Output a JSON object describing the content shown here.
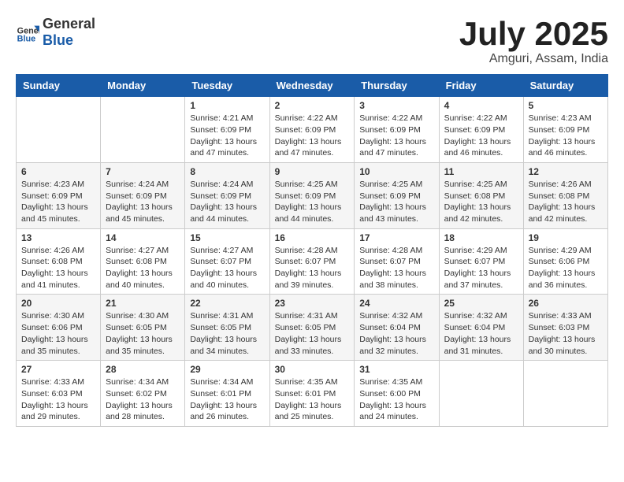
{
  "header": {
    "logo_general": "General",
    "logo_blue": "Blue",
    "month_title": "July 2025",
    "location": "Amguri, Assam, India"
  },
  "days_of_week": [
    "Sunday",
    "Monday",
    "Tuesday",
    "Wednesday",
    "Thursday",
    "Friday",
    "Saturday"
  ],
  "weeks": [
    [
      {
        "day": "",
        "info": ""
      },
      {
        "day": "",
        "info": ""
      },
      {
        "day": "1",
        "info": "Sunrise: 4:21 AM\nSunset: 6:09 PM\nDaylight: 13 hours and 47 minutes."
      },
      {
        "day": "2",
        "info": "Sunrise: 4:22 AM\nSunset: 6:09 PM\nDaylight: 13 hours and 47 minutes."
      },
      {
        "day": "3",
        "info": "Sunrise: 4:22 AM\nSunset: 6:09 PM\nDaylight: 13 hours and 47 minutes."
      },
      {
        "day": "4",
        "info": "Sunrise: 4:22 AM\nSunset: 6:09 PM\nDaylight: 13 hours and 46 minutes."
      },
      {
        "day": "5",
        "info": "Sunrise: 4:23 AM\nSunset: 6:09 PM\nDaylight: 13 hours and 46 minutes."
      }
    ],
    [
      {
        "day": "6",
        "info": "Sunrise: 4:23 AM\nSunset: 6:09 PM\nDaylight: 13 hours and 45 minutes."
      },
      {
        "day": "7",
        "info": "Sunrise: 4:24 AM\nSunset: 6:09 PM\nDaylight: 13 hours and 45 minutes."
      },
      {
        "day": "8",
        "info": "Sunrise: 4:24 AM\nSunset: 6:09 PM\nDaylight: 13 hours and 44 minutes."
      },
      {
        "day": "9",
        "info": "Sunrise: 4:25 AM\nSunset: 6:09 PM\nDaylight: 13 hours and 44 minutes."
      },
      {
        "day": "10",
        "info": "Sunrise: 4:25 AM\nSunset: 6:09 PM\nDaylight: 13 hours and 43 minutes."
      },
      {
        "day": "11",
        "info": "Sunrise: 4:25 AM\nSunset: 6:08 PM\nDaylight: 13 hours and 42 minutes."
      },
      {
        "day": "12",
        "info": "Sunrise: 4:26 AM\nSunset: 6:08 PM\nDaylight: 13 hours and 42 minutes."
      }
    ],
    [
      {
        "day": "13",
        "info": "Sunrise: 4:26 AM\nSunset: 6:08 PM\nDaylight: 13 hours and 41 minutes."
      },
      {
        "day": "14",
        "info": "Sunrise: 4:27 AM\nSunset: 6:08 PM\nDaylight: 13 hours and 40 minutes."
      },
      {
        "day": "15",
        "info": "Sunrise: 4:27 AM\nSunset: 6:07 PM\nDaylight: 13 hours and 40 minutes."
      },
      {
        "day": "16",
        "info": "Sunrise: 4:28 AM\nSunset: 6:07 PM\nDaylight: 13 hours and 39 minutes."
      },
      {
        "day": "17",
        "info": "Sunrise: 4:28 AM\nSunset: 6:07 PM\nDaylight: 13 hours and 38 minutes."
      },
      {
        "day": "18",
        "info": "Sunrise: 4:29 AM\nSunset: 6:07 PM\nDaylight: 13 hours and 37 minutes."
      },
      {
        "day": "19",
        "info": "Sunrise: 4:29 AM\nSunset: 6:06 PM\nDaylight: 13 hours and 36 minutes."
      }
    ],
    [
      {
        "day": "20",
        "info": "Sunrise: 4:30 AM\nSunset: 6:06 PM\nDaylight: 13 hours and 35 minutes."
      },
      {
        "day": "21",
        "info": "Sunrise: 4:30 AM\nSunset: 6:05 PM\nDaylight: 13 hours and 35 minutes."
      },
      {
        "day": "22",
        "info": "Sunrise: 4:31 AM\nSunset: 6:05 PM\nDaylight: 13 hours and 34 minutes."
      },
      {
        "day": "23",
        "info": "Sunrise: 4:31 AM\nSunset: 6:05 PM\nDaylight: 13 hours and 33 minutes."
      },
      {
        "day": "24",
        "info": "Sunrise: 4:32 AM\nSunset: 6:04 PM\nDaylight: 13 hours and 32 minutes."
      },
      {
        "day": "25",
        "info": "Sunrise: 4:32 AM\nSunset: 6:04 PM\nDaylight: 13 hours and 31 minutes."
      },
      {
        "day": "26",
        "info": "Sunrise: 4:33 AM\nSunset: 6:03 PM\nDaylight: 13 hours and 30 minutes."
      }
    ],
    [
      {
        "day": "27",
        "info": "Sunrise: 4:33 AM\nSunset: 6:03 PM\nDaylight: 13 hours and 29 minutes."
      },
      {
        "day": "28",
        "info": "Sunrise: 4:34 AM\nSunset: 6:02 PM\nDaylight: 13 hours and 28 minutes."
      },
      {
        "day": "29",
        "info": "Sunrise: 4:34 AM\nSunset: 6:01 PM\nDaylight: 13 hours and 26 minutes."
      },
      {
        "day": "30",
        "info": "Sunrise: 4:35 AM\nSunset: 6:01 PM\nDaylight: 13 hours and 25 minutes."
      },
      {
        "day": "31",
        "info": "Sunrise: 4:35 AM\nSunset: 6:00 PM\nDaylight: 13 hours and 24 minutes."
      },
      {
        "day": "",
        "info": ""
      },
      {
        "day": "",
        "info": ""
      }
    ]
  ]
}
